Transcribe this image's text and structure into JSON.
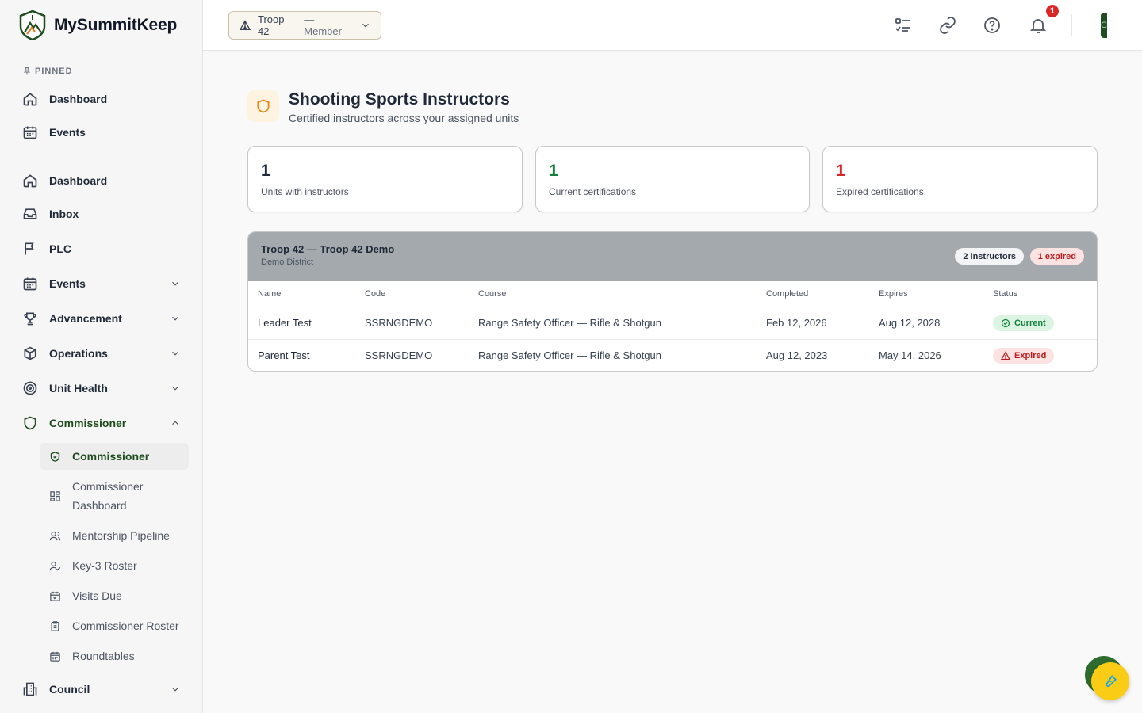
{
  "brand": {
    "name": "MySummitKeep"
  },
  "sidebar": {
    "pinned_label": "PINNED",
    "pinned": [
      {
        "label": "Dashboard",
        "icon": "home-icon"
      },
      {
        "label": "Events",
        "icon": "calendar-icon"
      }
    ],
    "items": [
      {
        "label": "Dashboard",
        "icon": "home-icon"
      },
      {
        "label": "Inbox",
        "icon": "inbox-icon"
      },
      {
        "label": "PLC",
        "icon": "flag-icon"
      },
      {
        "label": "Events",
        "icon": "calendar-icon"
      },
      {
        "label": "Advancement",
        "icon": "trophy-icon"
      },
      {
        "label": "Operations",
        "icon": "box-icon"
      },
      {
        "label": "Unit Health",
        "icon": "target-icon"
      },
      {
        "label": "Commissioner",
        "icon": "shield-icon"
      },
      {
        "label": "Council",
        "icon": "building-icon"
      }
    ],
    "commissioner_sub": [
      {
        "label": "Commissioner",
        "icon": "shield-check-icon"
      },
      {
        "label": "Commissioner Dashboard",
        "icon": "grid-icon"
      },
      {
        "label": "Mentorship Pipeline",
        "icon": "users-icon"
      },
      {
        "label": "Key-3 Roster",
        "icon": "user-check-icon"
      },
      {
        "label": "Visits Due",
        "icon": "calendar-check-icon"
      },
      {
        "label": "Commissioner Roster",
        "icon": "clipboard-icon"
      },
      {
        "label": "Roundtables",
        "icon": "calendar-grid-icon"
      }
    ]
  },
  "topbar": {
    "unit": "Troop 42",
    "role": "— Member",
    "notification_count": "1",
    "avatar_initial": "C"
  },
  "page": {
    "title": "Shooting Sports Instructors",
    "subtitle": "Certified instructors across your assigned units"
  },
  "stats": [
    {
      "value": "1",
      "label": "Units with instructors",
      "color": "#1f2937"
    },
    {
      "value": "1",
      "label": "Current certifications",
      "color": "#15803d"
    },
    {
      "value": "1",
      "label": "Expired certifications",
      "color": "#dc2626"
    }
  ],
  "unit_table": {
    "title": "Troop 42 — Troop 42 Demo",
    "district": "Demo District",
    "instructor_count": "2 instructors",
    "expired_count": "1 expired",
    "columns": [
      "Name",
      "Code",
      "Course",
      "Completed",
      "Expires",
      "Status"
    ],
    "rows": [
      {
        "name": "Leader Test",
        "code": "SSRNGDEMO",
        "course": "Range Safety Officer — Rifle & Shotgun",
        "completed": "Feb 12, 2026",
        "expires": "Aug 12, 2028",
        "status": "Current"
      },
      {
        "name": "Parent Test",
        "code": "SSRNGDEMO",
        "course": "Range Safety Officer — Rifle & Shotgun",
        "completed": "Aug 12, 2023",
        "expires": "May 14, 2026",
        "status": "Expired"
      }
    ]
  },
  "colors": {
    "brand_green": "#1f4d1f",
    "accent_yellow": "#facc15",
    "danger": "#dc2626",
    "success": "#15803d"
  }
}
